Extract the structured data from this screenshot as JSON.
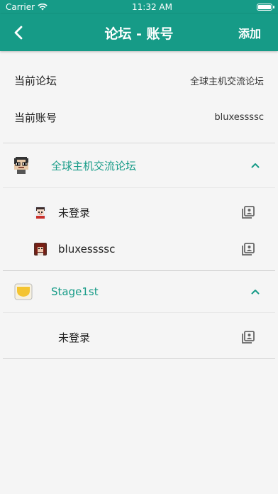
{
  "status_bar": {
    "carrier": "Carrier",
    "time": "11:32 AM"
  },
  "nav": {
    "title": "论坛 - 账号",
    "action_label": "添加"
  },
  "current": {
    "forum_label": "当前论坛",
    "forum_value": "全球主机交流论坛",
    "account_label": "当前账号",
    "account_value": "bluxessssc"
  },
  "forums": [
    {
      "name": "全球主机交流论坛",
      "icon": "pixel-avatar-icon",
      "accounts": [
        {
          "name": "未登录",
          "avatar": "guest-avatar"
        },
        {
          "name": "bluxessssc",
          "avatar": "user-avatar"
        }
      ]
    },
    {
      "name": "Stage1st",
      "icon": "stage1st-logo-icon",
      "accounts": [
        {
          "name": "未登录",
          "avatar": ""
        }
      ]
    }
  ],
  "colors": {
    "accent": "#169b87",
    "background": "#f5f5f5",
    "icon_gray": "#666666"
  }
}
